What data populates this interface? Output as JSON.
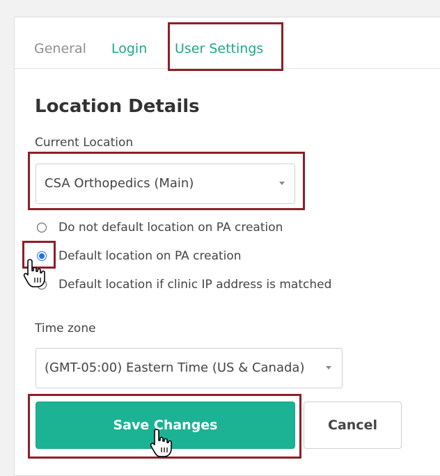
{
  "tabs": [
    {
      "label": "General",
      "active": false
    },
    {
      "label": "Login",
      "active": false
    },
    {
      "label": "User Settings",
      "active": true
    }
  ],
  "section": {
    "title": "Location Details"
  },
  "current_location": {
    "label": "Current Location",
    "selected": "CSA Orthopedics (Main)"
  },
  "location_default_options": [
    {
      "label": "Do not default location on PA creation",
      "checked": false
    },
    {
      "label": "Default location on PA creation",
      "checked": true
    },
    {
      "label": "Default location if clinic IP address is matched",
      "checked": false
    }
  ],
  "time_zone": {
    "label": "Time zone",
    "selected": "(GMT-05:00) Eastern Time (US & Canada)"
  },
  "actions": {
    "save_label": "Save Changes",
    "cancel_label": "Cancel"
  },
  "colors": {
    "accent": "#1cb394",
    "tab_link": "#1ea58b",
    "highlight": "#8f1d27",
    "radio_checked": "#1a73e8"
  }
}
